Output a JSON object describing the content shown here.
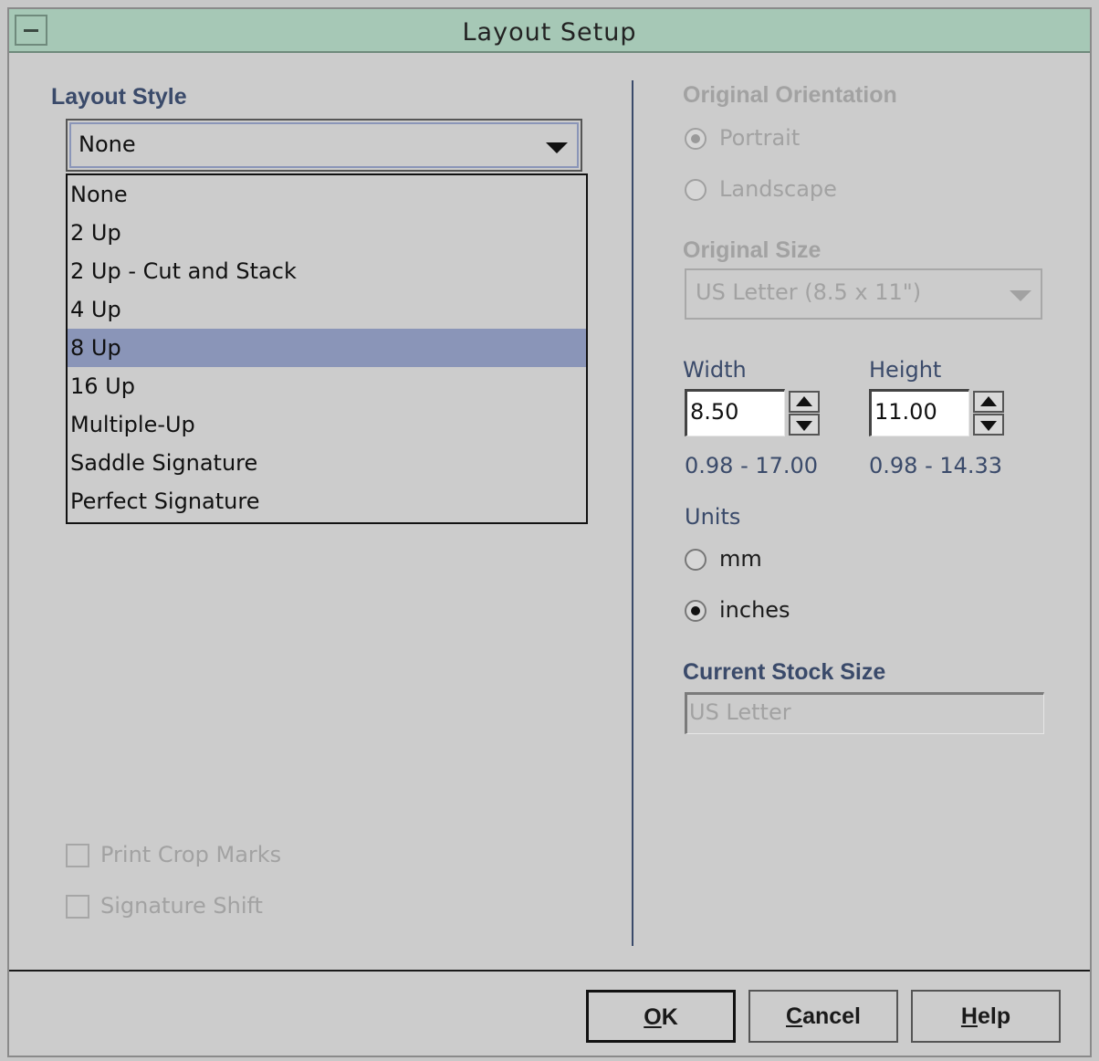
{
  "window": {
    "title": "Layout Setup",
    "system_menu_icon": "minus-icon"
  },
  "layout_style": {
    "label": "Layout Style",
    "selected": "None",
    "highlighted": "8 Up",
    "options": [
      "None",
      "2 Up",
      "2 Up - Cut and Stack",
      "4 Up",
      "8 Up",
      "16 Up",
      "Multiple-Up",
      "Saddle Signature",
      "Perfect Signature"
    ]
  },
  "options": {
    "print_crop_marks": {
      "label": "Print Crop Marks",
      "checked": false,
      "enabled": false
    },
    "signature_shift": {
      "label": "Signature Shift",
      "checked": false,
      "enabled": false
    }
  },
  "orientation": {
    "label": "Original Orientation",
    "portrait": "Portrait",
    "landscape": "Landscape",
    "selected": "Portrait",
    "enabled": false
  },
  "original_size": {
    "label": "Original Size",
    "selected": "US Letter (8.5 x 11\")",
    "enabled": false
  },
  "dimensions": {
    "width_label": "Width",
    "width_value": "8.50",
    "width_range": "0.98 - 17.00",
    "height_label": "Height",
    "height_value": "11.00",
    "height_range": "0.98 - 14.33"
  },
  "units": {
    "label": "Units",
    "mm": "mm",
    "inches": "inches",
    "selected": "inches"
  },
  "stock": {
    "label": "Current Stock Size",
    "value": "US Letter"
  },
  "buttons": {
    "ok_mnemonic": "O",
    "ok_rest": "K",
    "cancel_mnemonic": "C",
    "cancel_rest": "ancel",
    "help_mnemonic": "H",
    "help_rest": "elp"
  },
  "colors": {
    "titlebar": "#a6c8b6",
    "highlight": "#8a95b8",
    "label_blue": "#3a4a6a",
    "disabled": "#a2a2a2"
  }
}
